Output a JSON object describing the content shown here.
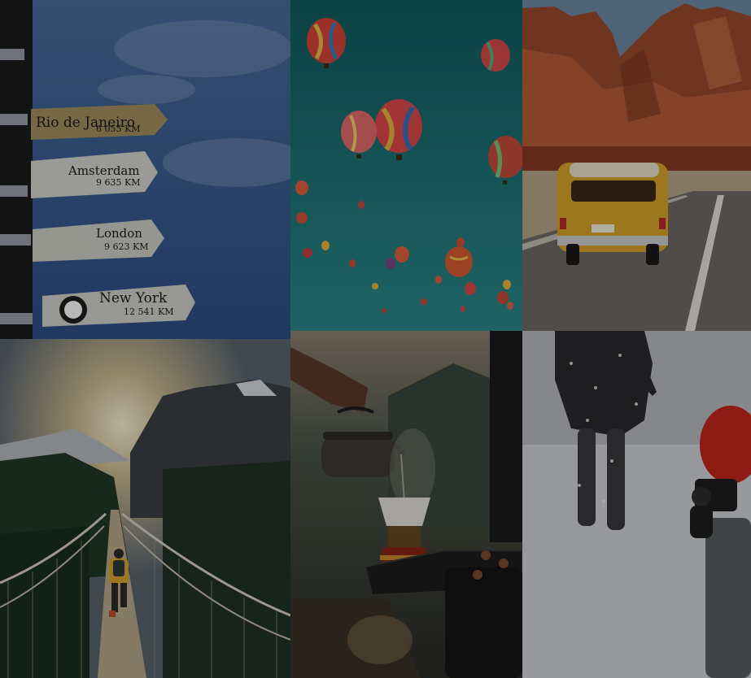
{
  "signs": [
    {
      "city": "Rio de Janeiro",
      "distance": "6 055 KM"
    },
    {
      "city": "Amsterdam",
      "distance": "9 635 KM"
    },
    {
      "city": "London",
      "distance": "9 623 KM"
    },
    {
      "city": "New York",
      "distance": "12 541 KM"
    }
  ]
}
